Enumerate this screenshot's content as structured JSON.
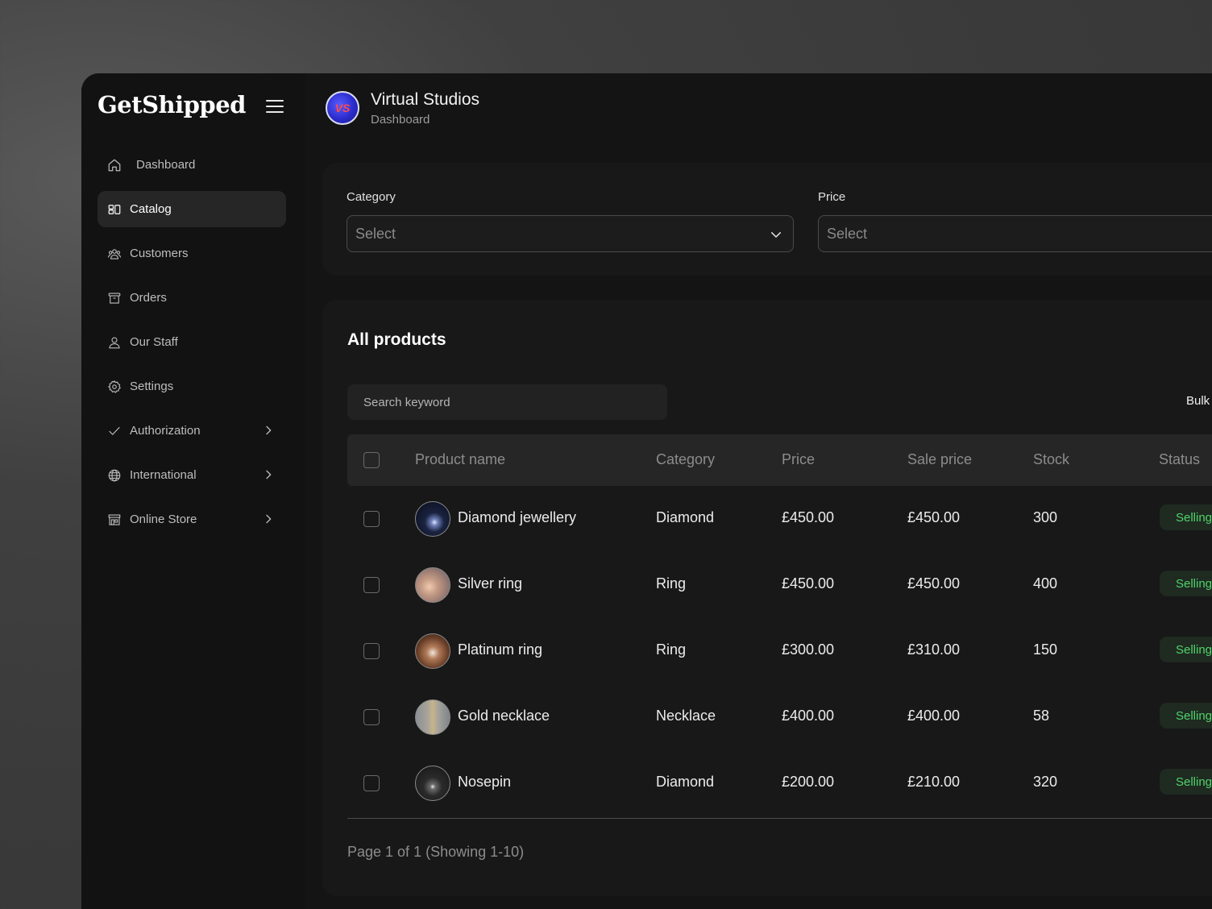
{
  "sidebar": {
    "brand": "GetShipped",
    "items": [
      {
        "label": "Dashboard",
        "icon": "home-icon"
      },
      {
        "label": "Catalog",
        "icon": "catalog-icon",
        "active": true
      },
      {
        "label": "Customers",
        "icon": "customers-icon"
      },
      {
        "label": "Orders",
        "icon": "orders-icon"
      },
      {
        "label": "Our Staff",
        "icon": "user-icon"
      },
      {
        "label": "Settings",
        "icon": "gear-icon"
      },
      {
        "label": "Authorization",
        "icon": "check-icon",
        "expandable": true
      },
      {
        "label": "International",
        "icon": "globe-icon",
        "expandable": true
      },
      {
        "label": "Online Store",
        "icon": "store-icon",
        "expandable": true
      }
    ]
  },
  "header": {
    "avatar_initials": "VS",
    "org_name": "Virtual Studios",
    "subtitle": "Dashboard"
  },
  "filters": {
    "category": {
      "label": "Category",
      "value": "Select"
    },
    "price": {
      "label": "Price",
      "value": "Select"
    }
  },
  "products": {
    "title": "All products",
    "search_placeholder": "Search keyword",
    "bulk_label": "Bulk",
    "columns": {
      "name": "Product name",
      "category": "Category",
      "price": "Price",
      "sale_price": "Sale price",
      "stock": "Stock",
      "status": "Status"
    },
    "rows": [
      {
        "name": "Diamond jewellery",
        "category": "Diamond",
        "price": "£450.00",
        "sale_price": "£450.00",
        "stock": "300",
        "status": "Selling"
      },
      {
        "name": "Silver ring",
        "category": "Ring",
        "price": "£450.00",
        "sale_price": "£450.00",
        "stock": "400",
        "status": "Selling"
      },
      {
        "name": "Platinum ring",
        "category": "Ring",
        "price": "£300.00",
        "sale_price": "£310.00",
        "stock": "150",
        "status": "Selling"
      },
      {
        "name": "Gold necklace",
        "category": "Necklace",
        "price": "£400.00",
        "sale_price": "£400.00",
        "stock": "58",
        "status": "Selling"
      },
      {
        "name": "Nosepin",
        "category": "Diamond",
        "price": "£200.00",
        "sale_price": "£210.00",
        "stock": "320",
        "status": "Selling"
      }
    ],
    "pagination": "Page 1 of 1 (Showing 1-10)"
  },
  "colors": {
    "background": "#141414",
    "card": "#181818",
    "accent_active": "#262626",
    "status_text": "#4fd46a",
    "status_bg": "#1f2a21"
  }
}
